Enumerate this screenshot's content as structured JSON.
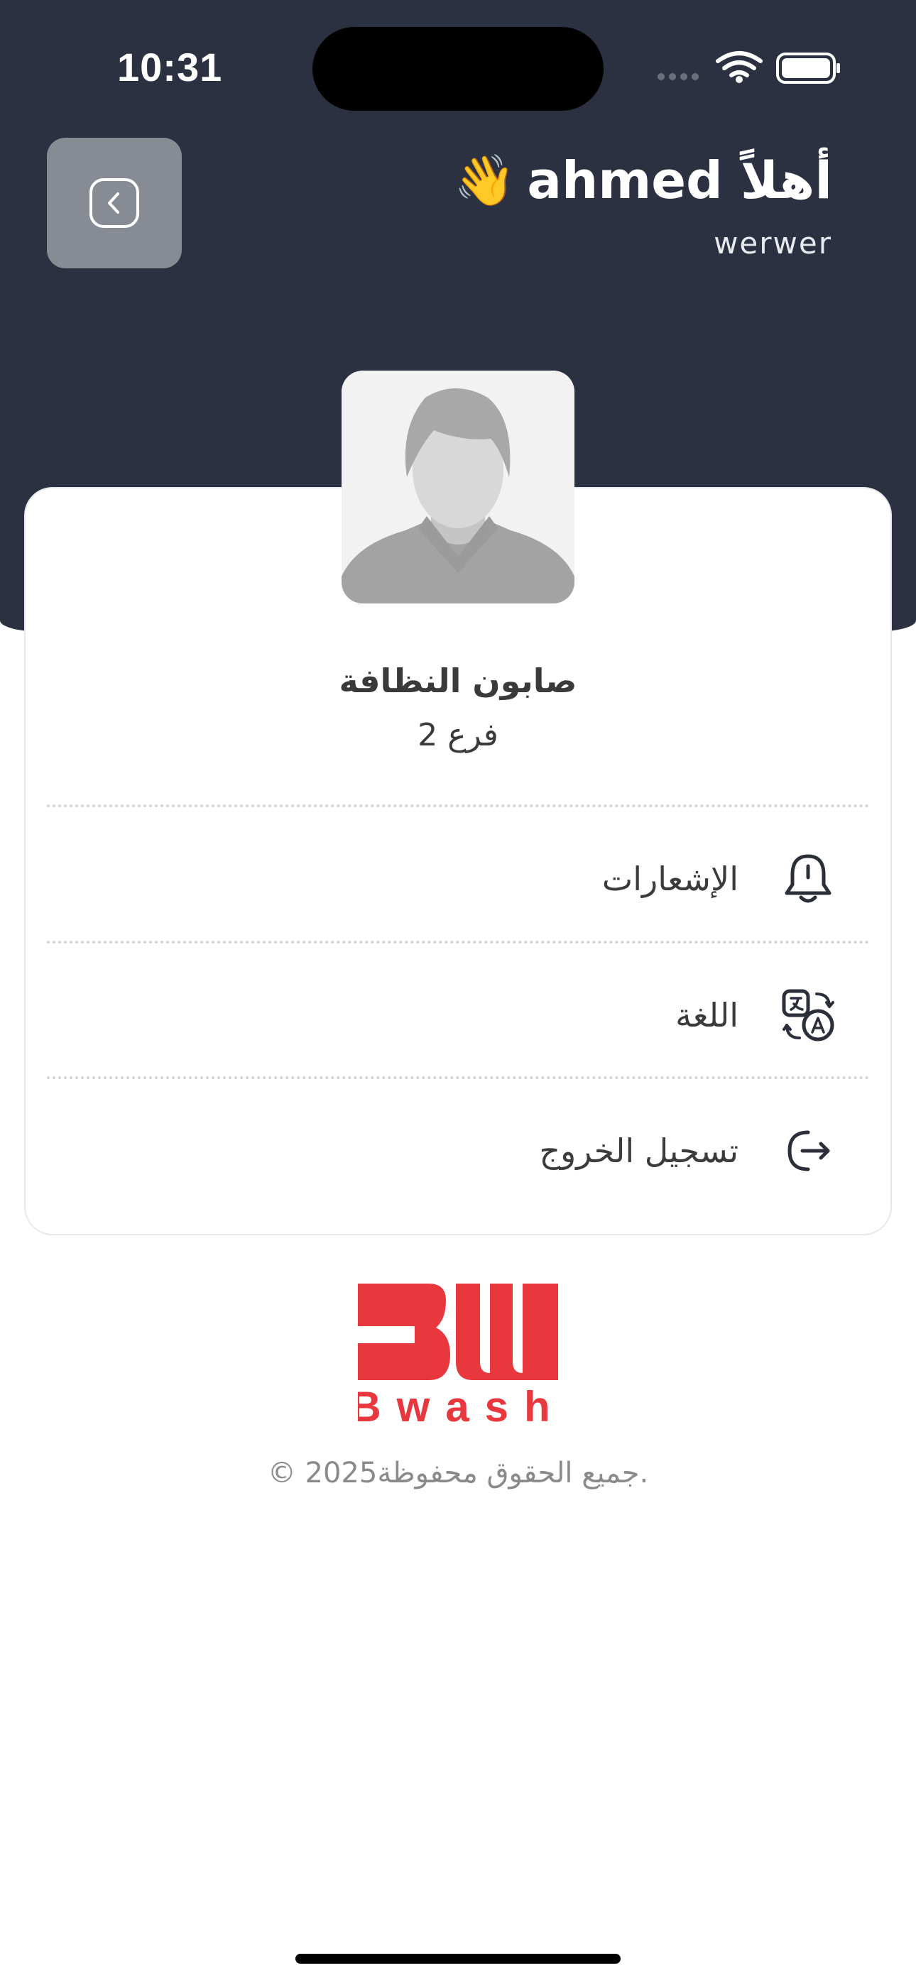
{
  "status_bar": {
    "time": "10:31"
  },
  "header": {
    "greeting_text": "أهلاً ahmed",
    "greeting_emoji": "👋",
    "subtitle": "werwer",
    "back_icon": "chevron-left-square-icon"
  },
  "profile": {
    "avatar_icon": "default-user-avatar",
    "name": "صابون النظافة",
    "branch": "فرع 2"
  },
  "menu": {
    "items": [
      {
        "label": "الإشعارات",
        "icon": "bell-icon"
      },
      {
        "label": "اللغة",
        "icon": "translate-icon"
      },
      {
        "label": "تسجيل الخروج",
        "icon": "logout-icon"
      }
    ]
  },
  "brand": {
    "logo_letters": "BW",
    "logo_word": "Bwash",
    "color": "#e8383d"
  },
  "footer": {
    "copyright": "© 2025جميع الحقوق محفوظة."
  },
  "colors": {
    "header_bg": "#2c3142",
    "back_button_bg": "#878b93",
    "accent": "#e8383d"
  }
}
